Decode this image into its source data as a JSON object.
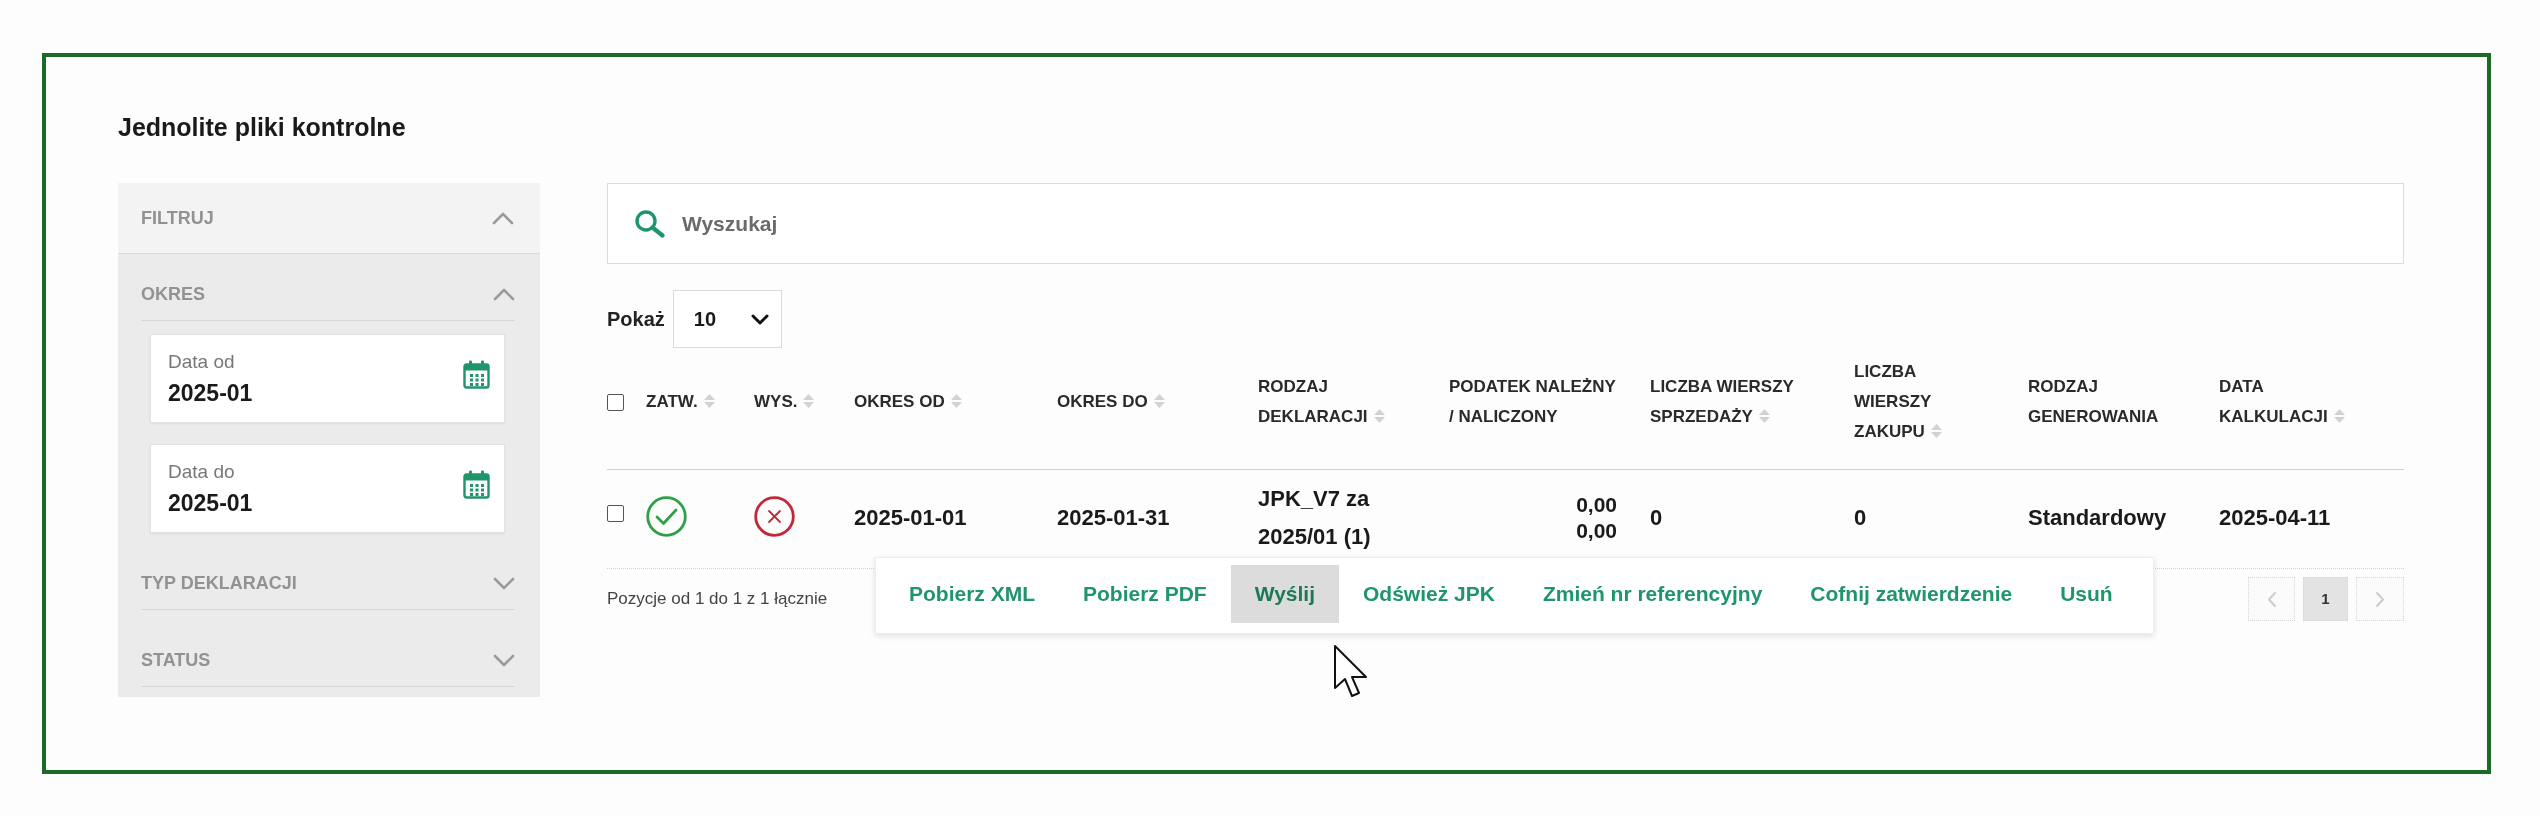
{
  "page": {
    "title": "Jednolite pliki kontrolne"
  },
  "filter_panel": {
    "title": "FILTRUJ",
    "expanded": true,
    "sections": [
      {
        "title": "OKRES",
        "expanded": true,
        "fields": [
          {
            "label": "Data od",
            "value": "2025-01"
          },
          {
            "label": "Data do",
            "value": "2025-01"
          }
        ]
      },
      {
        "title": "TYP DEKLARACJI",
        "expanded": false
      },
      {
        "title": "STATUS",
        "expanded": false
      }
    ]
  },
  "search": {
    "placeholder": "Wyszukaj"
  },
  "page_size": {
    "label": "Pokaż",
    "value": "10"
  },
  "table": {
    "select_all": {
      "checked": false
    },
    "columns": [
      {
        "label": "ZATW.",
        "sortable": true
      },
      {
        "label": "WYS.",
        "sortable": true
      },
      {
        "label": "OKRES OD",
        "sortable": true
      },
      {
        "label": "OKRES DO",
        "sortable": true
      },
      {
        "label": "RODZAJ DEKLARACJI",
        "sortable": true
      },
      {
        "label": "PODATEK NALEŻNY / NALICZONY",
        "sortable": false
      },
      {
        "label": "LICZBA WIERSZY SPRZEDAŻY",
        "sortable": true
      },
      {
        "label": "LICZBA WIERSZY ZAKUPU",
        "sortable": true
      },
      {
        "label": "RODZAJ GENEROWANIA",
        "sortable": false
      },
      {
        "label": "DATA KALKULACJI",
        "sortable": true
      }
    ],
    "rows": [
      {
        "checked": false,
        "cells": [
          {
            "kind": "status",
            "ok": true
          },
          {
            "kind": "status",
            "ok": false
          },
          {
            "kind": "text",
            "text": "2025-01-01"
          },
          {
            "kind": "text",
            "text": "2025-01-31"
          },
          {
            "kind": "text",
            "text": "JPK_V7 za 2025/01 (1)"
          },
          {
            "kind": "amounts",
            "lines": [
              "0,00",
              "0,00"
            ]
          },
          {
            "kind": "text",
            "text": "0"
          },
          {
            "kind": "text",
            "text": "0"
          },
          {
            "kind": "text",
            "text": "Standardowy"
          },
          {
            "kind": "text",
            "text": "2025-04-11"
          }
        ]
      }
    ]
  },
  "footer": {
    "summary": "Pozycje od 1 do 1 z 1 łącznie"
  },
  "pagination": {
    "prev": {
      "disabled": true
    },
    "pages": [
      {
        "label": "1",
        "selected": true
      }
    ],
    "next": {
      "disabled": true
    }
  },
  "row_menu": {
    "items": [
      {
        "label": "Pobierz XML",
        "selected": false
      },
      {
        "label": "Pobierz PDF",
        "selected": false
      },
      {
        "label": "Wyślij",
        "selected": true
      },
      {
        "label": "Odśwież JPK",
        "selected": false
      },
      {
        "label": "Zmień nr referencyjny",
        "selected": false
      },
      {
        "label": "Cofnij zatwierdzenie",
        "selected": false
      },
      {
        "label": "Usuń",
        "selected": false
      }
    ]
  }
}
